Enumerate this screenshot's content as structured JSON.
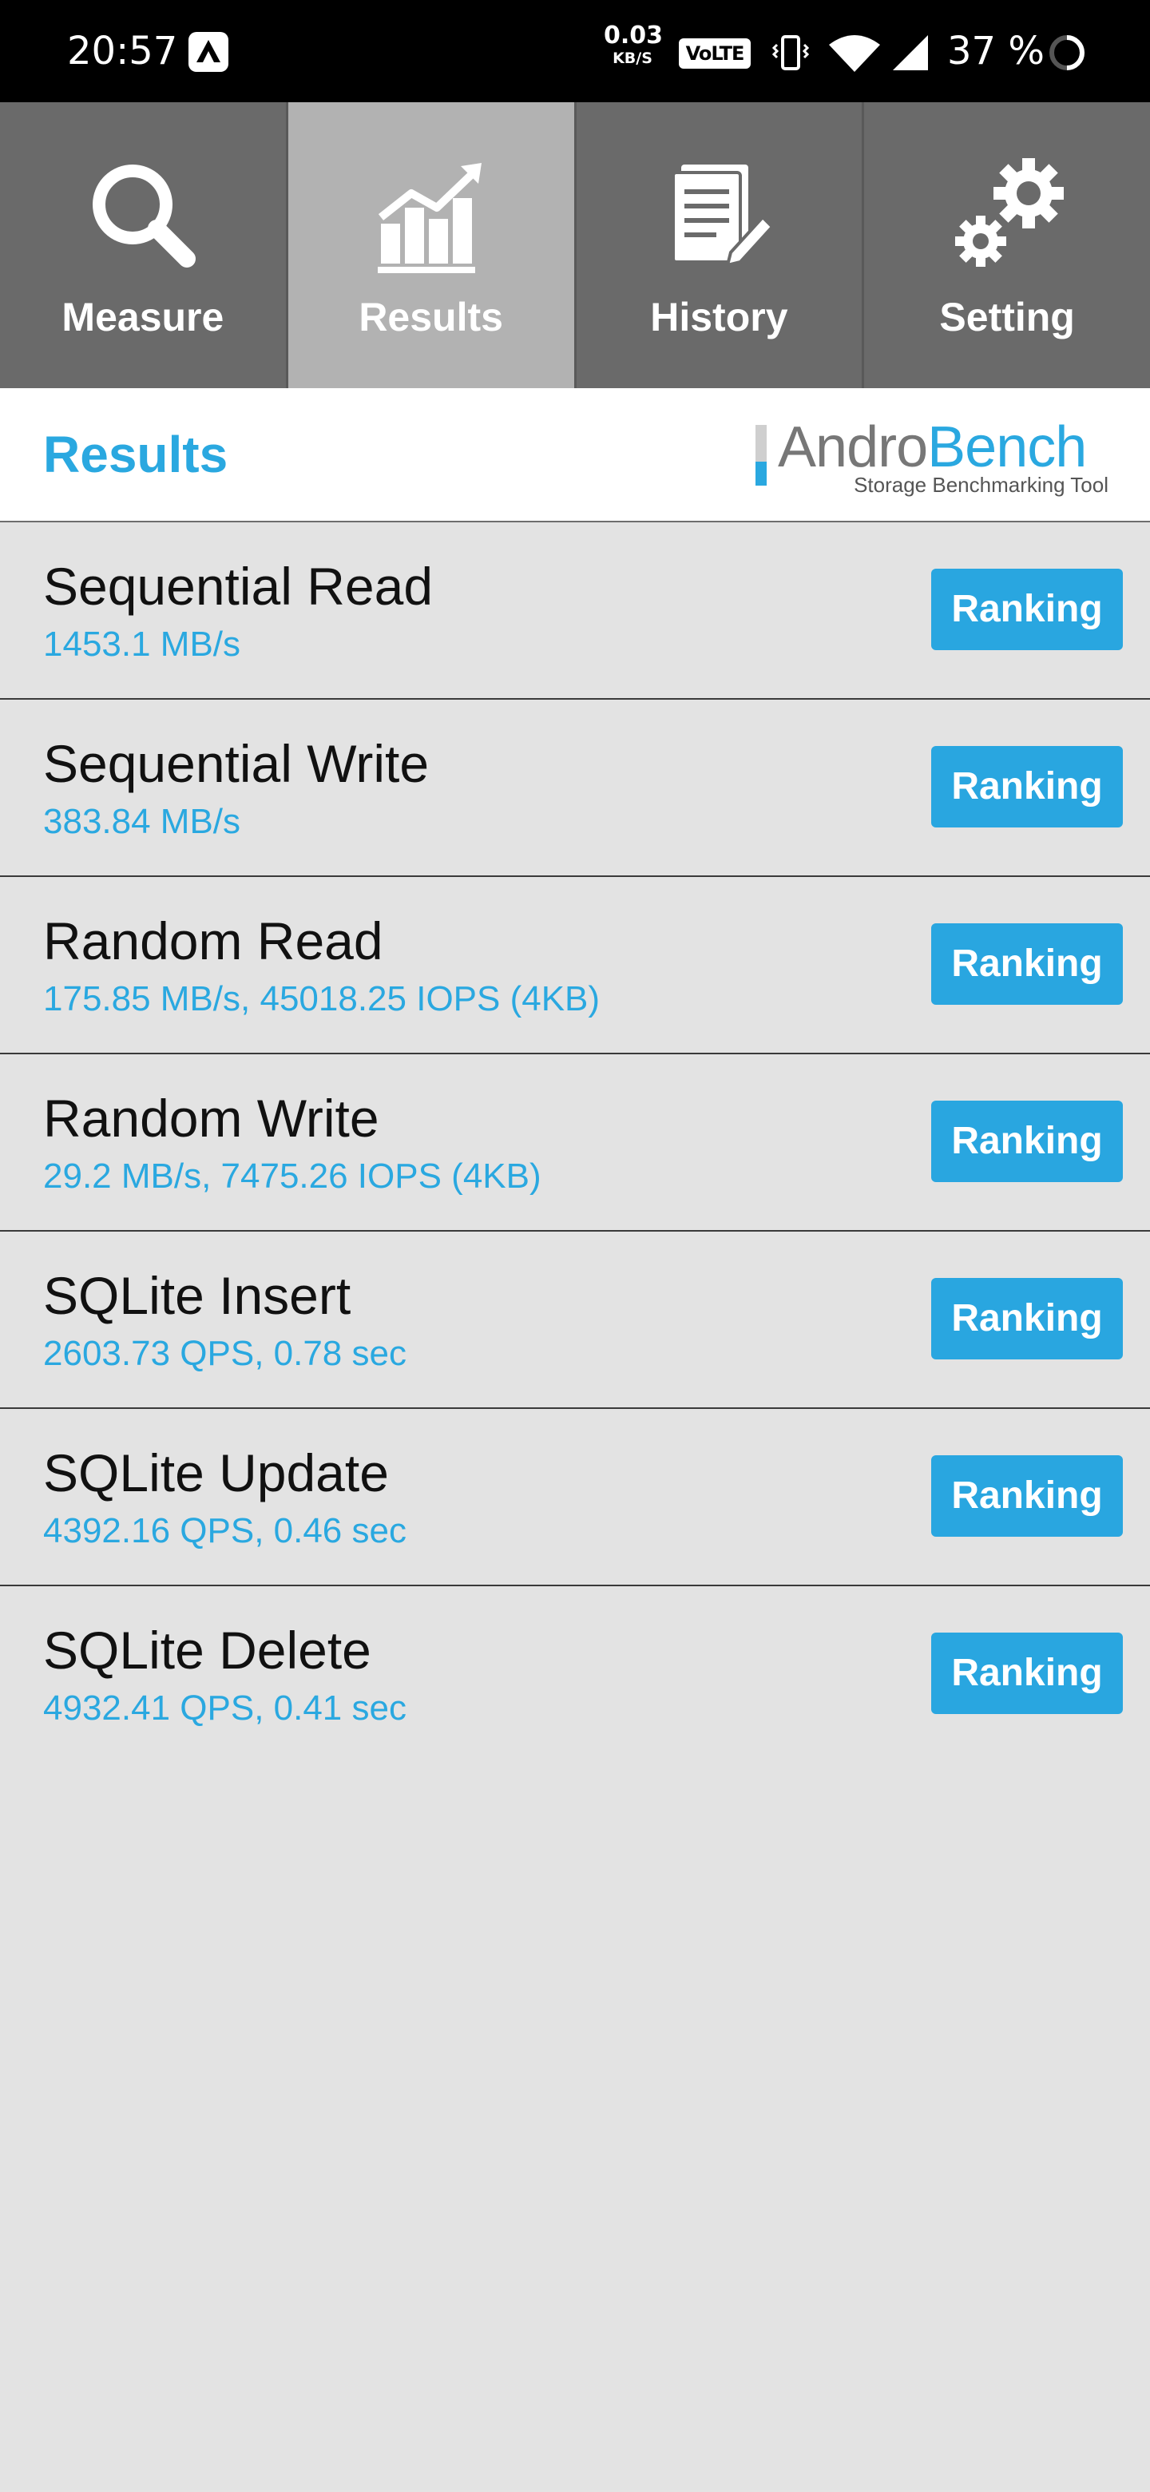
{
  "status_bar": {
    "time": "20:57",
    "net_speed_value": "0.03",
    "net_speed_unit": "KB/S",
    "volte": "VoLTE",
    "battery": "37 %"
  },
  "tabs": [
    {
      "label": "Measure",
      "icon": "magnifier-icon",
      "active": false
    },
    {
      "label": "Results",
      "icon": "chart-icon",
      "active": true
    },
    {
      "label": "History",
      "icon": "document-icon",
      "active": false
    },
    {
      "label": "Setting",
      "icon": "gears-icon",
      "active": false
    }
  ],
  "header": {
    "title": "Results",
    "logo_andro": "Andro",
    "logo_bench": "Bench",
    "logo_tagline": "Storage Benchmarking Tool"
  },
  "colors": {
    "accent": "#2aa8e0",
    "tab_bg": "#6a6a6a",
    "tab_active_bg": "#b2b2b2",
    "list_bg": "#e3e3e3"
  },
  "results": [
    {
      "name": "Sequential Read",
      "value": "1453.1 MB/s",
      "button": "Ranking"
    },
    {
      "name": "Sequential Write",
      "value": "383.84 MB/s",
      "button": "Ranking"
    },
    {
      "name": "Random Read",
      "value": "175.85 MB/s, 45018.25 IOPS (4KB)",
      "button": "Ranking"
    },
    {
      "name": "Random Write",
      "value": "29.2 MB/s, 7475.26 IOPS (4KB)",
      "button": "Ranking"
    },
    {
      "name": "SQLite Insert",
      "value": "2603.73 QPS, 0.78 sec",
      "button": "Ranking"
    },
    {
      "name": "SQLite Update",
      "value": "4392.16 QPS, 0.46 sec",
      "button": "Ranking"
    },
    {
      "name": "SQLite Delete",
      "value": "4932.41 QPS, 0.41 sec",
      "button": "Ranking"
    }
  ]
}
